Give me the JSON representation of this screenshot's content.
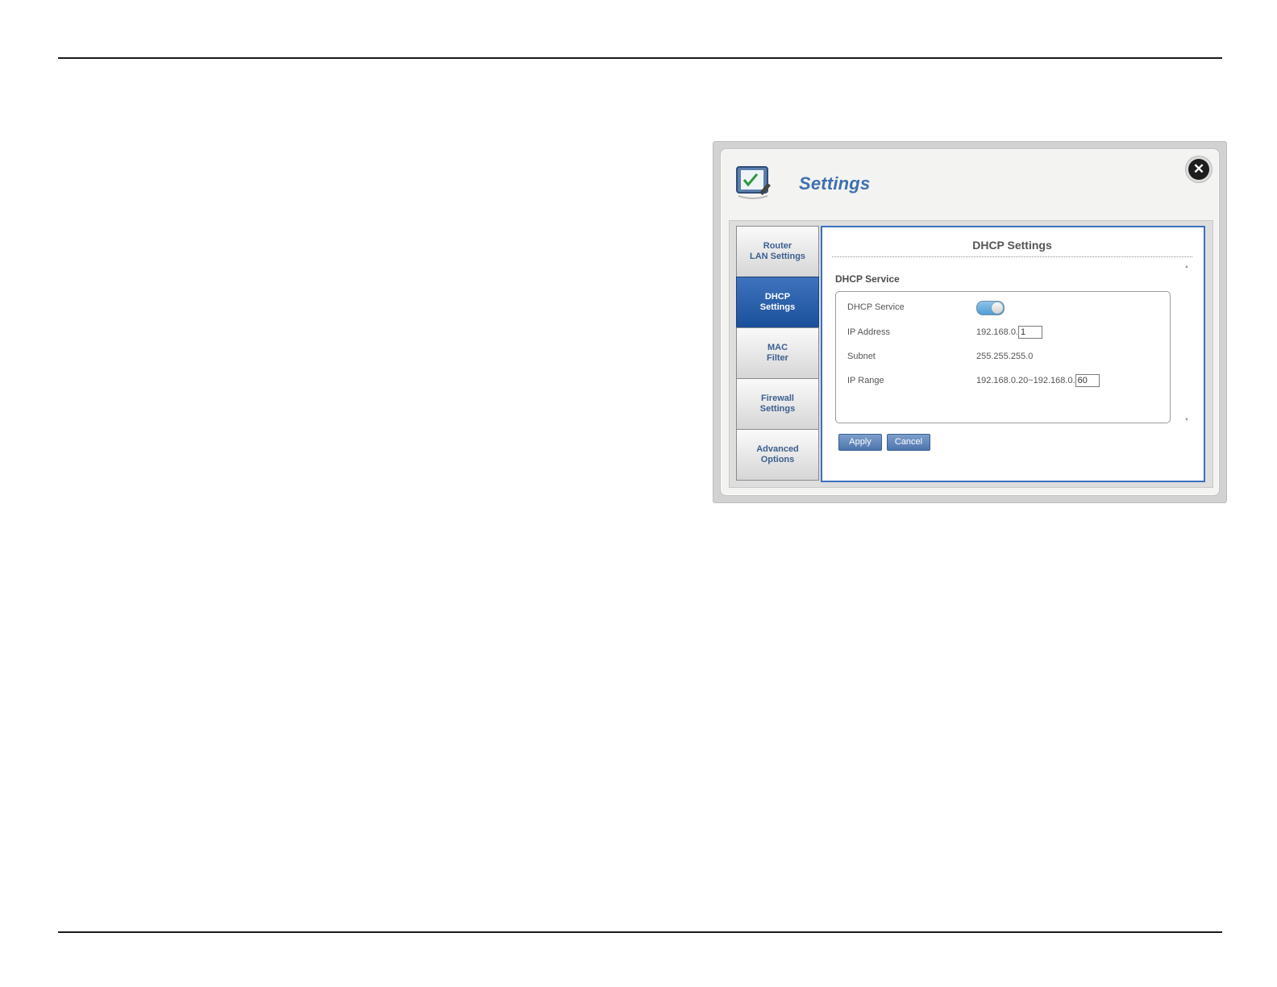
{
  "dialog": {
    "title": "Settings",
    "close_icon": "close-icon",
    "header_icon": "settings-checklist-icon"
  },
  "sidebar": {
    "items": [
      {
        "label": "Router\nLAN Settings",
        "active": false
      },
      {
        "label": "DHCP\nSettings",
        "active": true
      },
      {
        "label": "MAC\nFilter",
        "active": false
      },
      {
        "label": "Firewall\nSettings",
        "active": false
      },
      {
        "label": "Advanced\nOptions",
        "active": false
      }
    ]
  },
  "content": {
    "title": "DHCP Settings",
    "section_title": "DHCP Service",
    "fields": {
      "dhcp_service": {
        "label": "DHCP Service",
        "enabled": true
      },
      "ip_address": {
        "label": "IP Address",
        "prefix": "192.168.0.",
        "value": "1"
      },
      "subnet": {
        "label": "Subnet",
        "value": "255.255.255.0"
      },
      "ip_range": {
        "label": "IP Range",
        "prefix": "192.168.0.20~192.168.0.",
        "value": "60"
      }
    },
    "buttons": {
      "apply": "Apply",
      "cancel": "Cancel"
    }
  },
  "colors": {
    "accent": "#3b70c0",
    "active_tab": "#1a4f9a",
    "title": "#3f6fb0"
  }
}
